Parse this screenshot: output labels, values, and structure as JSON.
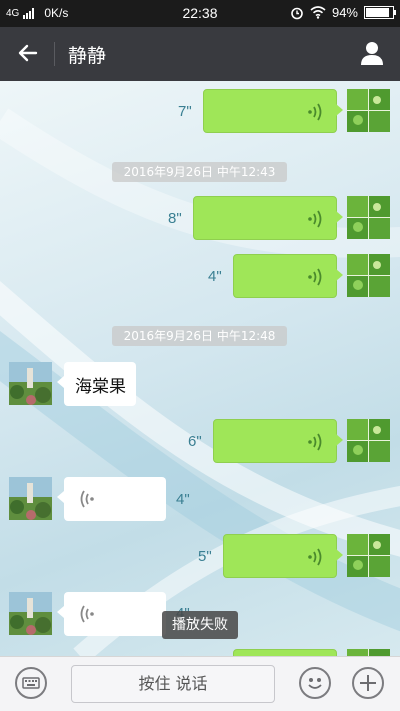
{
  "status_bar": {
    "network": "4G",
    "speed": "0K/s",
    "time": "22:38",
    "battery": "94%",
    "battery_level": 0.94
  },
  "header": {
    "title": "静静",
    "back_icon": "back-arrow-icon",
    "profile_icon": "person-icon"
  },
  "messages": {
    "m1": {
      "duration": "7\""
    },
    "ts1": "2016年9月26日 中午12:43",
    "m2": {
      "duration": "8\""
    },
    "m3": {
      "duration": "4\""
    },
    "ts2": "2016年9月26日 中午12:48",
    "m4": {
      "text": "海棠果"
    },
    "m5": {
      "duration": "6\""
    },
    "m6": {
      "duration": "4\""
    },
    "m7": {
      "duration": "5\""
    },
    "m8": {
      "duration": "4\""
    }
  },
  "toast": "播放失败",
  "input_bar": {
    "hold_to_talk": "按住 说话",
    "keyboard_icon": "keyboard-icon",
    "emoji_icon": "emoji-icon",
    "plus_icon": "plus-icon"
  },
  "colors": {
    "header_bg": "#393a3f",
    "sent_bubble": "#9fe658",
    "received_bubble": "#ffffff",
    "duration_text": "#3a7f92"
  }
}
